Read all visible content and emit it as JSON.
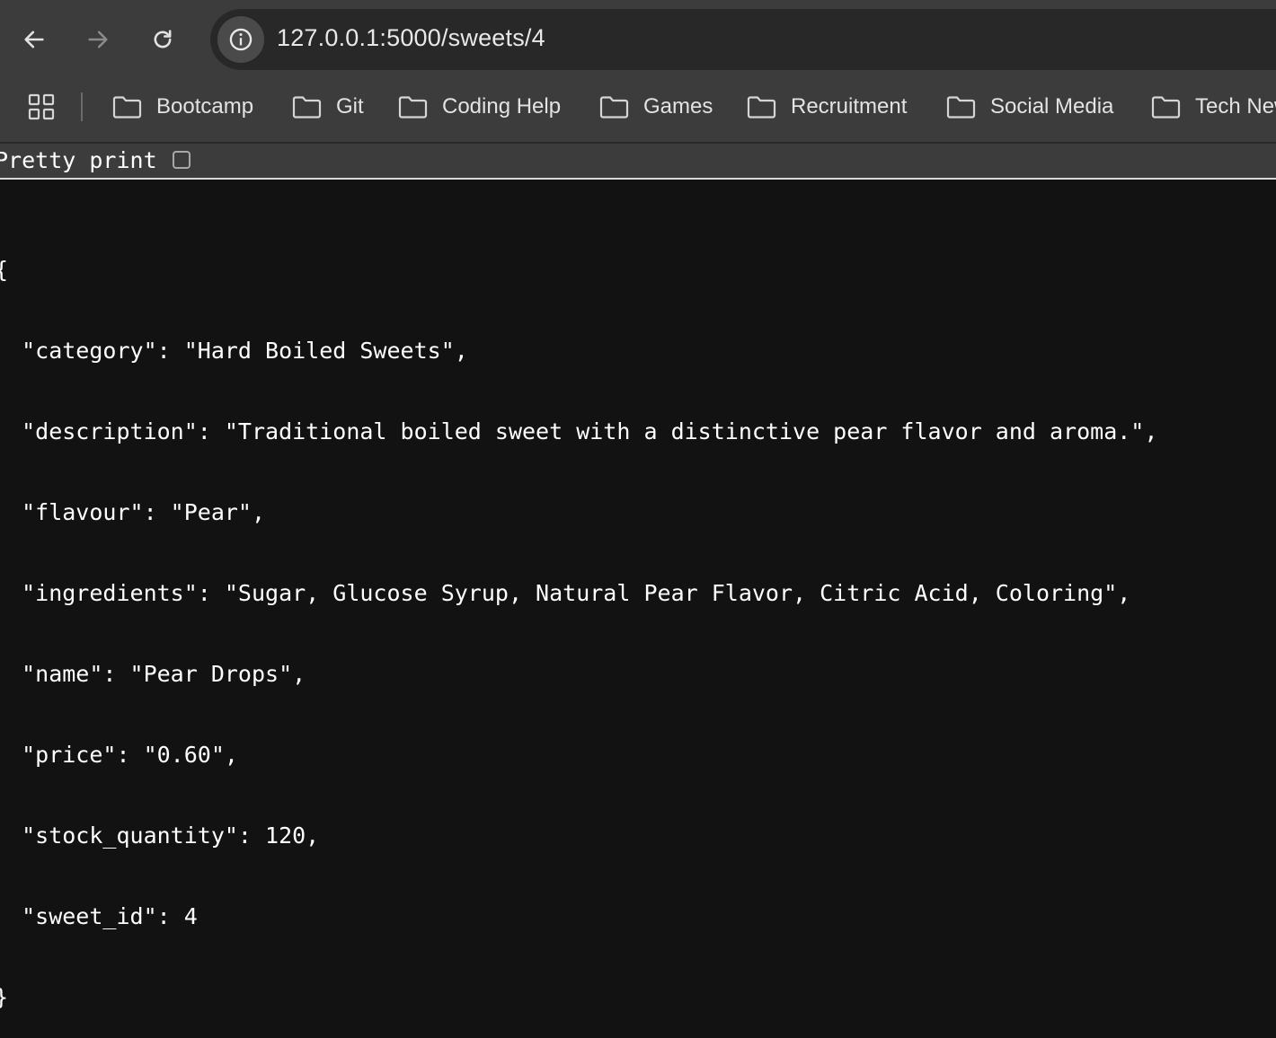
{
  "browser": {
    "url": "127.0.0.1:5000/sweets/4",
    "icons": {
      "back": "arrow-left-icon",
      "forward": "arrow-right-icon",
      "reload": "reload-icon",
      "site_info": "info-icon",
      "apps": "apps-grid-icon",
      "bookmark_folder": "folder-icon"
    }
  },
  "bookmarks": [
    {
      "label": "Bootcamp"
    },
    {
      "label": "Git"
    },
    {
      "label": "Coding Help"
    },
    {
      "label": "Games"
    },
    {
      "label": "Recruitment"
    },
    {
      "label": "Social Media"
    },
    {
      "label": "Tech News"
    }
  ],
  "pretty_print": {
    "label": "Pretty print",
    "checked": false
  },
  "json_lines": [
    "{",
    "  \"category\": \"Hard Boiled Sweets\",",
    "  \"description\": \"Traditional boiled sweet with a distinctive pear flavor and aroma.\",",
    "  \"flavour\": \"Pear\",",
    "  \"ingredients\": \"Sugar, Glucose Syrup, Natural Pear Flavor, Citric Acid, Coloring\",",
    "  \"name\": \"Pear Drops\",",
    "  \"price\": \"0.60\",",
    "  \"stock_quantity\": 120,",
    "  \"sweet_id\": 4",
    "}"
  ],
  "colors": {
    "toolbar": "#3c3c3c",
    "omnibox": "#282828",
    "page_background": "#121212",
    "text": "#ffffff"
  }
}
